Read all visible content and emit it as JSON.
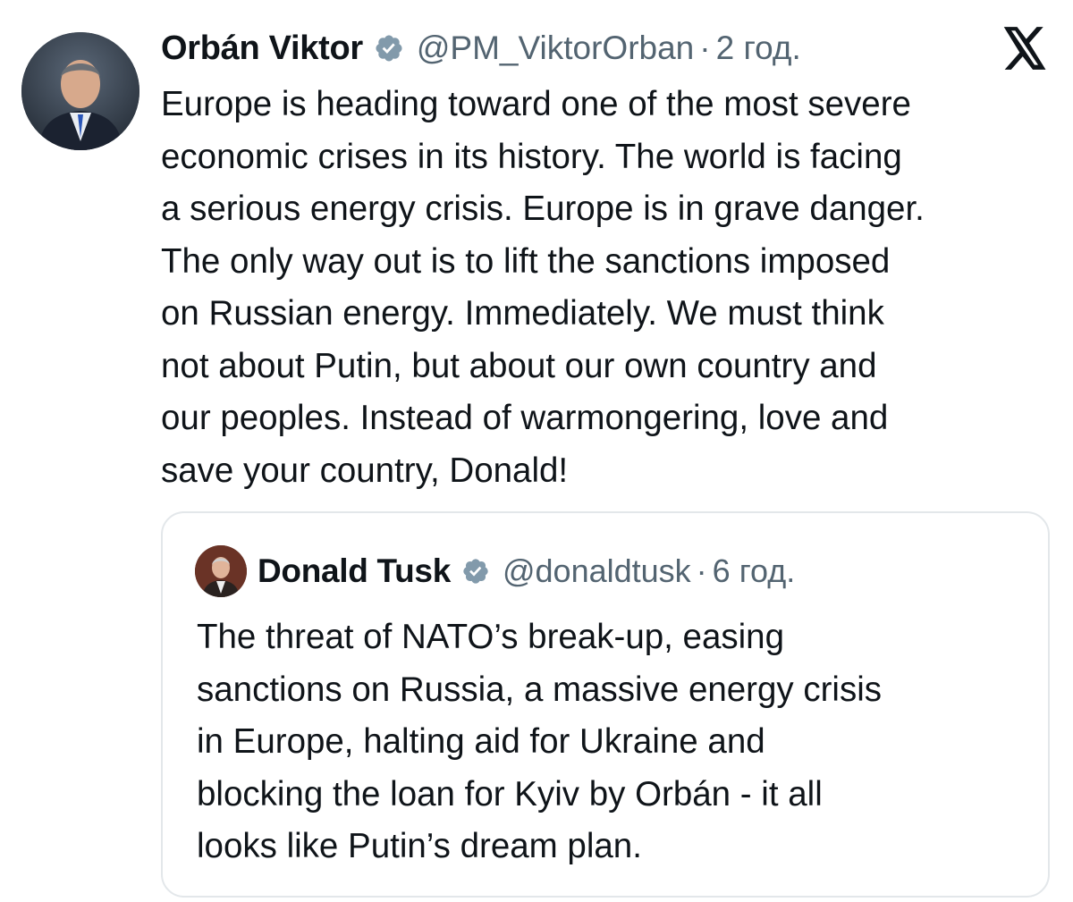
{
  "tweet": {
    "author_name": "Orbán Viktor",
    "handle": "@PM_ViktorOrban",
    "separator": "·",
    "time": "2 год.",
    "avatar_icon": "profile-photo",
    "verified_icon": "verified-badge-icon",
    "text_lines": [
      "Europe is heading toward one of the most severe",
      "economic crises in its history. The world is facing",
      "a serious energy crisis. Europe is in grave danger.",
      "The only way out is to lift the sanctions imposed",
      "on Russian energy. Immediately. We must think",
      "not about Putin, but about our own country and",
      "our peoples. Instead of warmongering, love and",
      "save your country, Donald!"
    ]
  },
  "app": {
    "logo_icon": "x-logo-icon"
  },
  "quoted_tweet": {
    "author_name": "Donald Tusk",
    "handle": "@donaldtusk",
    "separator": "·",
    "time": "6 год.",
    "avatar_icon": "profile-photo",
    "verified_icon": "verified-badge-icon",
    "text_lines": [
      "The threat of NATO’s break-up, easing",
      "sanctions on Russia, a massive energy crisis",
      "in Europe, halting aid for Ukraine and",
      "blocking the loan for Kyiv by Orbán - it all",
      "looks like Putin’s dream plan."
    ]
  },
  "colors": {
    "text_primary": "#0f1419",
    "text_secondary": "#536471",
    "verified_badge": "#829aab",
    "card_border": "#e3e7ea",
    "background": "#ffffff"
  }
}
